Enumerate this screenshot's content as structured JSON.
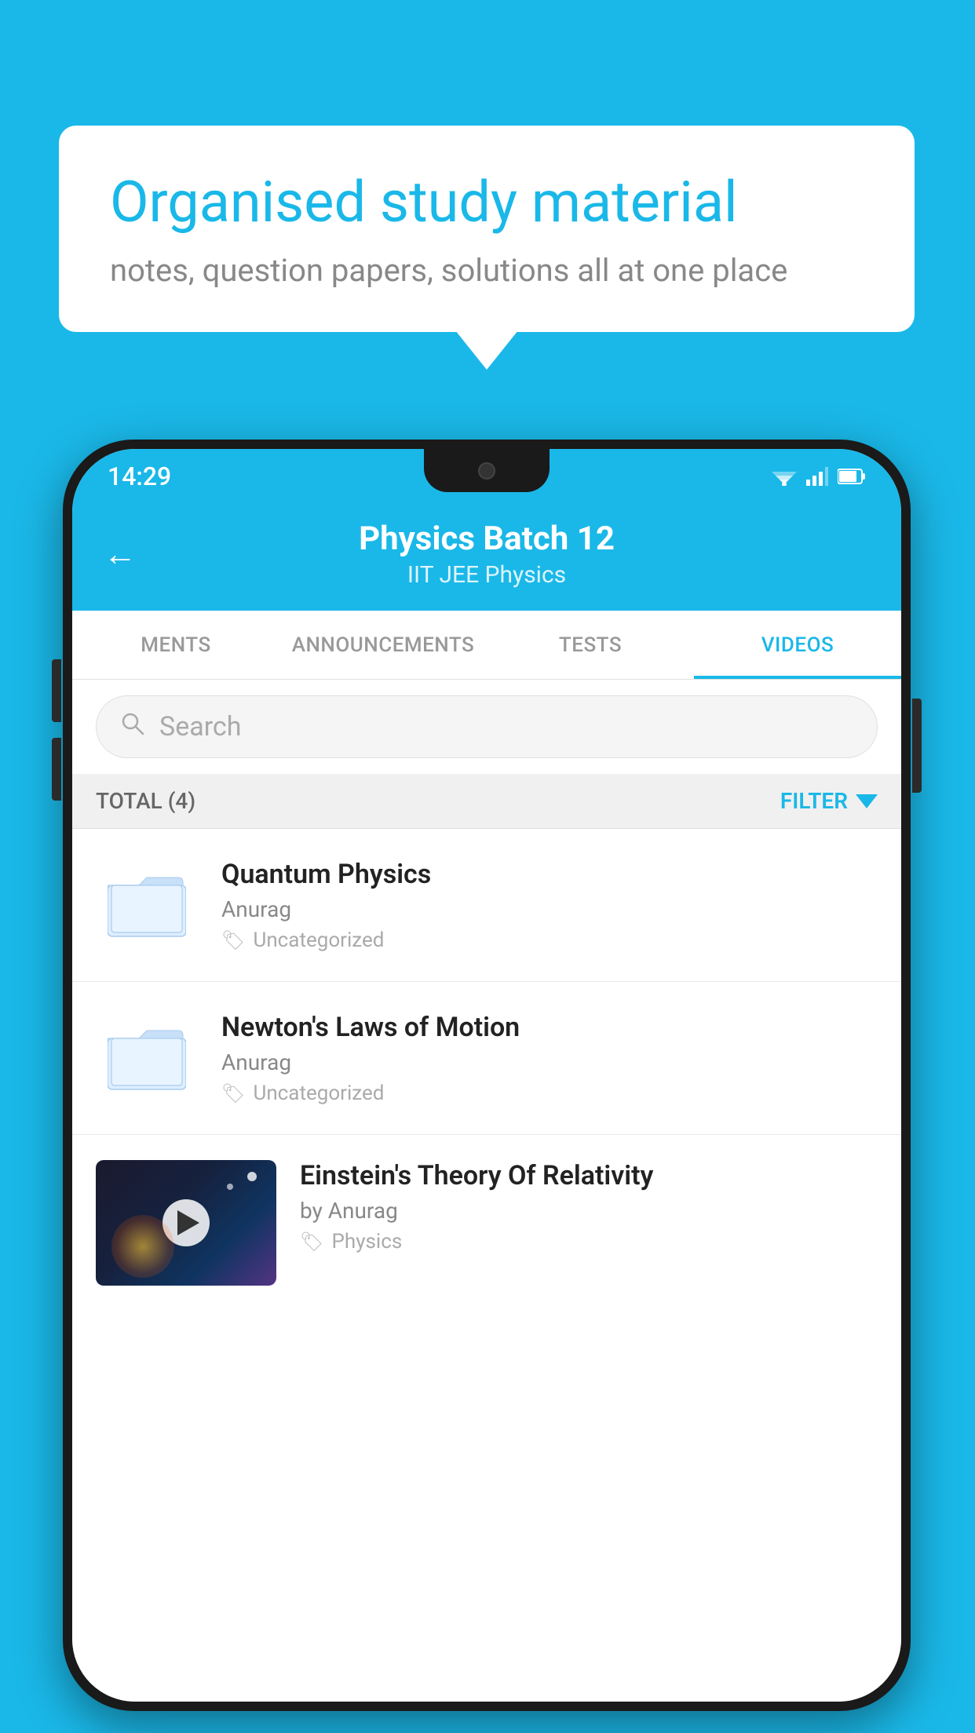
{
  "background": {
    "color": "#1ab8e8"
  },
  "speech_bubble": {
    "title": "Organised study material",
    "subtitle": "notes, question papers, solutions all at one place"
  },
  "status_bar": {
    "time": "14:29"
  },
  "app_bar": {
    "title": "Physics Batch 12",
    "subtitle": "IIT JEE   Physics",
    "back_label": "←"
  },
  "tabs": [
    {
      "label": "MENTS",
      "active": false
    },
    {
      "label": "ANNOUNCEMENTS",
      "active": false
    },
    {
      "label": "TESTS",
      "active": false
    },
    {
      "label": "VIDEOS",
      "active": true
    }
  ],
  "search": {
    "placeholder": "Search"
  },
  "filter_bar": {
    "total_label": "TOTAL (4)",
    "filter_label": "FILTER"
  },
  "videos": [
    {
      "id": 1,
      "title": "Quantum Physics",
      "author": "Anurag",
      "tag": "Uncategorized",
      "has_thumbnail": false
    },
    {
      "id": 2,
      "title": "Newton's Laws of Motion",
      "author": "Anurag",
      "tag": "Uncategorized",
      "has_thumbnail": false
    },
    {
      "id": 3,
      "title": "Einstein's Theory Of Relativity",
      "author": "by Anurag",
      "tag": "Physics",
      "has_thumbnail": true
    }
  ]
}
